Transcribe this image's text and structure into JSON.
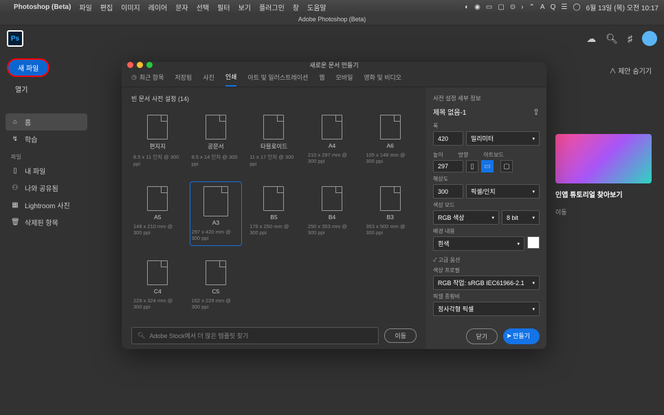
{
  "menubar": {
    "app": "Photoshop (Beta)",
    "items": [
      "파일",
      "편집",
      "이미지",
      "레이어",
      "문자",
      "선택",
      "필터",
      "보기",
      "플러그인",
      "창",
      "도움말"
    ],
    "date": "6월 13일 (목) 오전 10:17"
  },
  "titlebar": "Adobe Photoshop (Beta)",
  "sidebar": {
    "new_file": "새 파일",
    "open": "열기",
    "nav": {
      "home": "홈",
      "learn": "학습",
      "files_label": "파일",
      "my_files": "내 파일",
      "shared": "나와 공유됨",
      "lightroom": "Lightroom 사진",
      "deleted": "삭제된 항목"
    }
  },
  "main": {
    "suggestions": "∧  제안 숨기기",
    "promo_title": "인앱 튜토리얼 찾아보기",
    "promo_sub": "이동"
  },
  "modal": {
    "title": "새로운 문서 만들기",
    "tabs": {
      "recent": "최근 항목",
      "saved": "저장됨",
      "photo": "사진",
      "print": "인쇄",
      "art": "아트 및 일러스트레이션",
      "web": "웹",
      "mobile": "모바일",
      "film": "영화 및 비디오"
    },
    "presets_header": "빈 문서 사전 설정 (14)",
    "presets": [
      {
        "name": "편지지",
        "meta": "8.5 x 11 인치 @ 300 ppi"
      },
      {
        "name": "공문서",
        "meta": "8.5 x 14 인치 @ 300 ppi"
      },
      {
        "name": "타블로이드",
        "meta": "11 x 17 인치 @ 300 ppi"
      },
      {
        "name": "A4",
        "meta": "210 x 297 mm @ 300 ppi"
      },
      {
        "name": "A6",
        "meta": "105 x 148 mm @ 300 ppi"
      },
      {
        "name": "A5",
        "meta": "148 x 210 mm @ 300 ppi"
      },
      {
        "name": "A3",
        "meta": "297 x 420 mm @ 300 ppi",
        "selected": true
      },
      {
        "name": "B5",
        "meta": "176 x 250 mm @ 300 ppi"
      },
      {
        "name": "B4",
        "meta": "250 x 353 mm @ 300 ppi"
      },
      {
        "name": "B3",
        "meta": "353 x 500 mm @ 300 ppi"
      },
      {
        "name": "C4",
        "meta": "229 x 324 mm @ 300 ppi"
      },
      {
        "name": "C5",
        "meta": "162 x 229 mm @ 300 ppi"
      }
    ],
    "stock_placeholder": "Adobe Stock에서 더 많은 템플릿 찾기",
    "go": "이동",
    "settings": {
      "header": "사전 설정 세부 정보",
      "title": "제목 없음-1",
      "width_label": "폭",
      "width": "420",
      "unit": "밀리미터",
      "height_label": "높이",
      "height": "297",
      "orient_label": "방향",
      "artboard_label": "아트보드",
      "res_label": "해상도",
      "res": "300",
      "res_unit": "픽셀/인치",
      "color_label": "색상 모드",
      "color_mode": "RGB 색상",
      "bit": "8 bit",
      "bg_label": "배경 내용",
      "bg": "흰색",
      "advanced": "✓ 고급 옵션",
      "profile_label": "색상 프로필",
      "profile": "RGB 작업: sRGB IEC61966-2.1",
      "aspect_label": "픽셀 종횡비",
      "aspect": "정사각형 픽셀"
    },
    "close": "닫기",
    "create": "만들기"
  }
}
